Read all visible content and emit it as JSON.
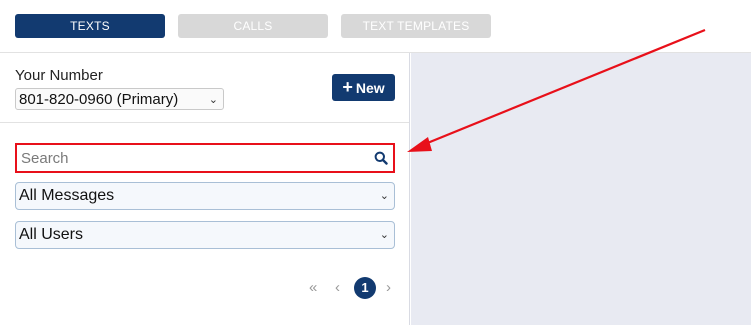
{
  "tabs": [
    {
      "label": "TEXTS",
      "state": "active"
    },
    {
      "label": "CALLS",
      "state": "inactive"
    },
    {
      "label": "TEXT TEMPLATES",
      "state": "inactive"
    }
  ],
  "sidebar": {
    "your_number_label": "Your Number",
    "number_select_value": "801-820-0960 (Primary)",
    "new_button_label": "New",
    "search_placeholder": "Search",
    "message_filter_value": "All Messages",
    "user_filter_value": "All Users",
    "pagination": {
      "first_glyph": "«",
      "prev_glyph": "‹",
      "current_page": "1",
      "next_glyph": "›"
    }
  },
  "colors": {
    "accent": "#123a70",
    "tab_inactive": "#d8d8d8",
    "highlight": "#e8101a",
    "content_bg": "#e8eaf2"
  },
  "icons": [
    "search-icon",
    "plus-icon",
    "chevron-down-icon",
    "double-chevron-left-icon",
    "chevron-left-icon",
    "chevron-right-icon"
  ]
}
